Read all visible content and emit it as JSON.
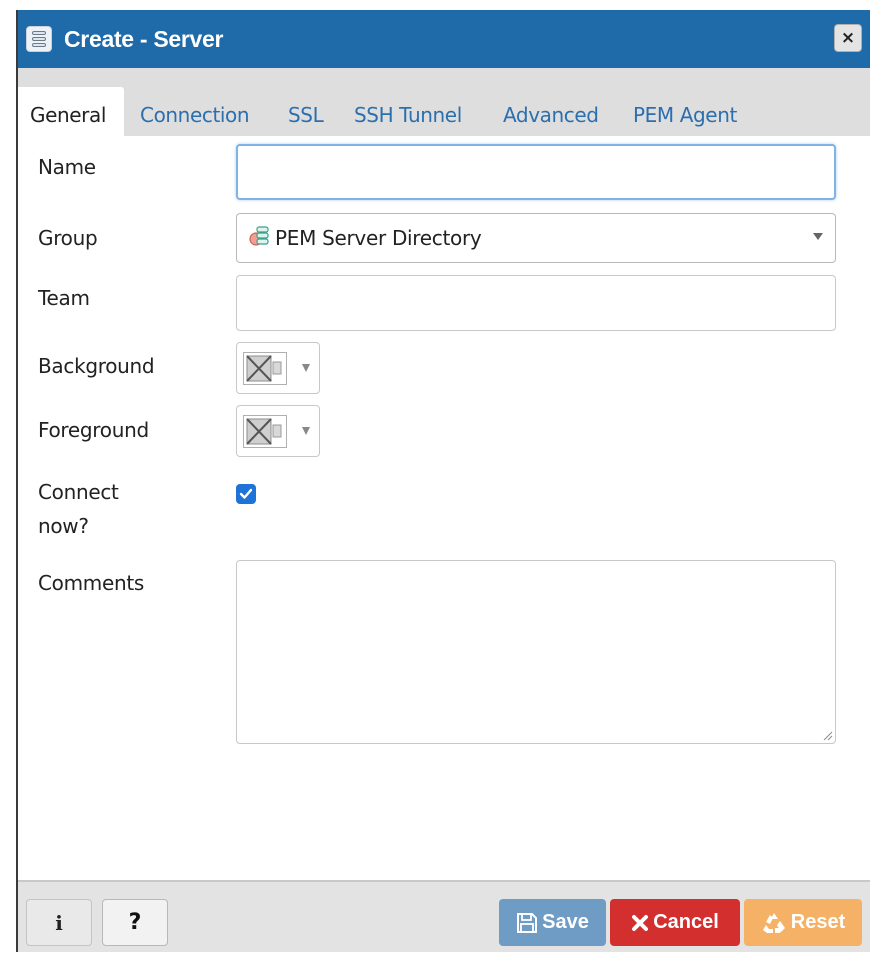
{
  "window": {
    "title": "Create - Server",
    "close_label": "×"
  },
  "tabs": [
    {
      "label": "General",
      "active": true
    },
    {
      "label": "Connection",
      "active": false
    },
    {
      "label": "SSL",
      "active": false
    },
    {
      "label": "SSH Tunnel",
      "active": false
    },
    {
      "label": "Advanced",
      "active": false
    },
    {
      "label": "PEM Agent",
      "active": false
    }
  ],
  "form": {
    "name": {
      "label": "Name",
      "value": ""
    },
    "group": {
      "label": "Group",
      "value": "PEM Server Directory",
      "icon": "server-group-icon"
    },
    "team": {
      "label": "Team",
      "value": ""
    },
    "background": {
      "label": "Background",
      "value": "none"
    },
    "foreground": {
      "label": "Foreground",
      "value": "none"
    },
    "connect_now": {
      "label_line1": "Connect",
      "label_line2": "now?",
      "checked": true
    },
    "comments": {
      "label": "Comments",
      "value": ""
    }
  },
  "footer": {
    "info_label": "i",
    "help_label": "?",
    "save_label": "Save",
    "cancel_label": "Cancel",
    "reset_label": "Reset"
  },
  "colors": {
    "titlebar": "#1f6aa8",
    "tab_link": "#2c6fae",
    "save": "#6e9cc4",
    "cancel": "#d32f2f",
    "reset": "#f5b266",
    "checkbox": "#1e73d9"
  }
}
